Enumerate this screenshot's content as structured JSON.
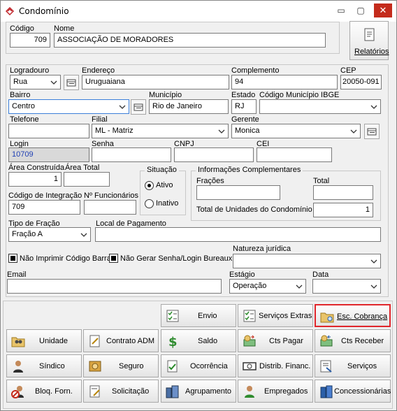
{
  "window": {
    "title": "Condomínio",
    "minimize_glyph": "▭",
    "maximize_glyph": "▢",
    "close_glyph": "✕"
  },
  "header": {
    "codigo_label": "Código",
    "codigo_value": "709",
    "nome_label": "Nome",
    "nome_value": "ASSOCIAÇÃO DE MORADORES",
    "relatorios_label": "Relatórios"
  },
  "address": {
    "logradouro_label": "Logradouro",
    "logradouro_value": "Rua",
    "endereco_label": "Endereço",
    "endereco_value": "Uruguaiana",
    "complemento_label": "Complemento",
    "complemento_value": "94",
    "cep_label": "CEP",
    "cep_value": "20050-091",
    "bairro_label": "Bairro",
    "bairro_value": "Centro",
    "municipio_label": "Município",
    "municipio_value": "Rio de Janeiro",
    "estado_label": "Estado",
    "estado_value": "RJ",
    "ibge_label": "Código Município IBGE",
    "ibge_value": ""
  },
  "contact": {
    "telefone_label": "Telefone",
    "telefone_value": "",
    "filial_label": "Filial",
    "filial_value": "ML - Matriz",
    "gerente_label": "Gerente",
    "gerente_value": "Monica",
    "login_label": "Login",
    "login_value": "10709",
    "senha_label": "Senha",
    "cnpj_label": "CNPJ",
    "cei_label": "CEI"
  },
  "areas": {
    "construida_label": "Área Construída",
    "construida_value": "1",
    "total_label": "Área Total",
    "total_value": "",
    "integracao_label": "Código de Integração",
    "integracao_value": "709",
    "funcionarios_label": "Nº Funcionários",
    "funcionarios_value": ""
  },
  "situacao": {
    "title": "Situação",
    "ativo_label": "Ativo",
    "inativo_label": "Inativo",
    "selected": "Ativo"
  },
  "info": {
    "title": "Informações Complementares",
    "fracoes_label": "Frações",
    "total_label": "Total",
    "unidades_label": "Total de Unidades do Condomínio",
    "unidades_value": "1"
  },
  "fracao": {
    "tipo_label": "Tipo de Fração",
    "tipo_value": "Fração A",
    "local_label": "Local de Pagamento",
    "local_value": ""
  },
  "flags": {
    "nao_imprimir_label": "Não Imprimir Código Barra",
    "nao_imprimir_checked": true,
    "nao_gerar_label": "Não Gerar Senha/Login Bureaux",
    "nao_gerar_checked": true,
    "natureza_label": "Natureza jurídica",
    "natureza_value": ""
  },
  "footer_fields": {
    "email_label": "Email",
    "email_value": "",
    "estagio_label": "Estágio",
    "estagio_value": "Operação",
    "data_label": "Data",
    "data_value": ""
  },
  "actions": {
    "envio": "Envio",
    "servicos_extras": "Serviços Extras",
    "esc_cobranca": "Esc. Cobrança",
    "unidade": "Unidade",
    "contrato_adm": "Contrato ADM",
    "saldo": "Saldo",
    "cts_pagar": "Cts Pagar",
    "cts_receber": "Cts Receber",
    "sindico": "Síndico",
    "seguro": "Seguro",
    "ocorrencia": "Ocorrência",
    "distrib_financ": "Distrib. Financ.",
    "servicos": "Serviços",
    "bloq_forn": "Bloq. Forn.",
    "solicitacao": "Solicitação",
    "agrupamento": "Agrupamento",
    "empregados": "Empregados",
    "concessionarias": "Concessionárias"
  },
  "colors": {
    "highlight_border": "#e0262b",
    "login_text": "#1f3fb4",
    "close_button": "#c42b1c"
  }
}
